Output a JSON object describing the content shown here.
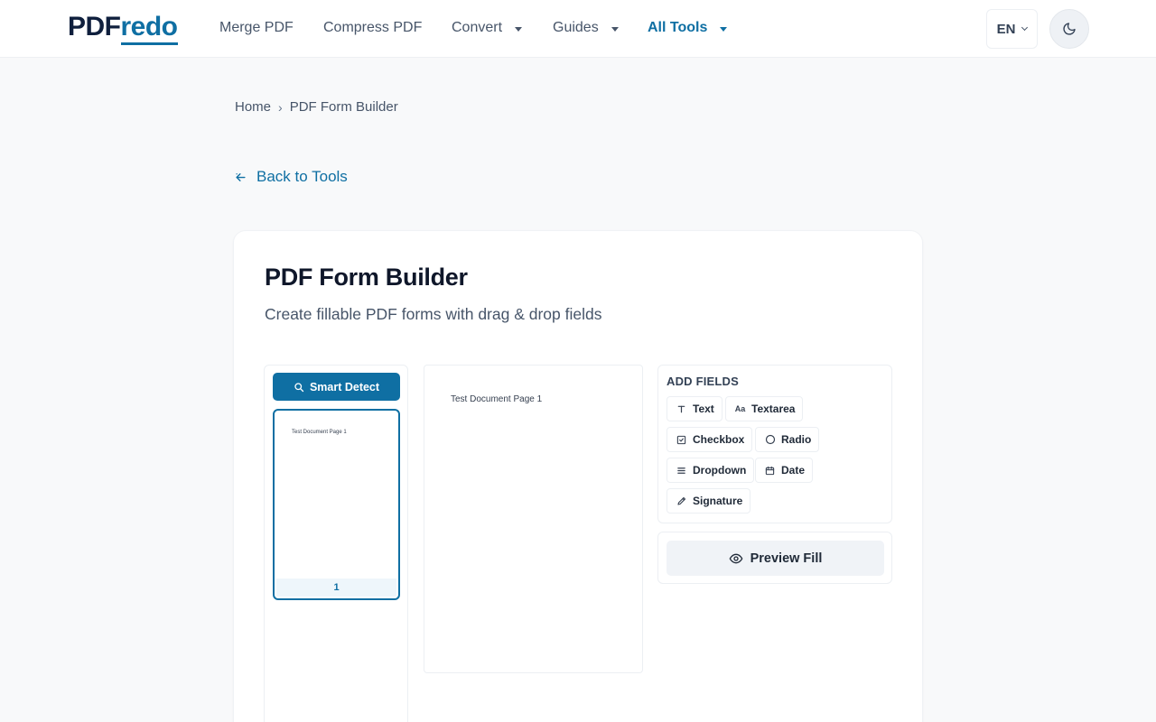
{
  "header": {
    "logo_part1": "PDF",
    "logo_part2": "redo",
    "nav": [
      {
        "label": "Merge PDF"
      },
      {
        "label": "Compress PDF"
      },
      {
        "label": "Convert"
      },
      {
        "label": "Guides"
      },
      {
        "label": "All Tools"
      }
    ],
    "language": "EN"
  },
  "breadcrumb": {
    "home": "Home",
    "separator": "›",
    "current": "PDF Form Builder"
  },
  "back_link": "Back to Tools",
  "tool": {
    "title": "PDF Form Builder",
    "subtitle": "Create fillable PDF forms with drag & drop fields"
  },
  "pages_panel": {
    "smart_detect_label": "Smart Detect",
    "thumbnail_text": "Test Document Page 1",
    "thumbnail_page_number": "1"
  },
  "document": {
    "page_text": "Test Document Page 1"
  },
  "fields_panel": {
    "title": "ADD FIELDS",
    "fields": [
      {
        "label": "Text",
        "icon": "text-field-icon"
      },
      {
        "label": "Textarea",
        "icon": "textarea-field-icon"
      },
      {
        "label": "Checkbox",
        "icon": "checkbox-field-icon"
      },
      {
        "label": "Radio",
        "icon": "radio-field-icon"
      },
      {
        "label": "Dropdown",
        "icon": "dropdown-field-icon"
      },
      {
        "label": "Date",
        "icon": "calendar-icon"
      },
      {
        "label": "Signature",
        "icon": "pen-icon"
      }
    ]
  },
  "preview": {
    "label": "Preview Fill"
  },
  "colors": {
    "accent": "#0f6fa3",
    "logo_dark": "#0f1f3d",
    "background": "#f8f9fa"
  }
}
